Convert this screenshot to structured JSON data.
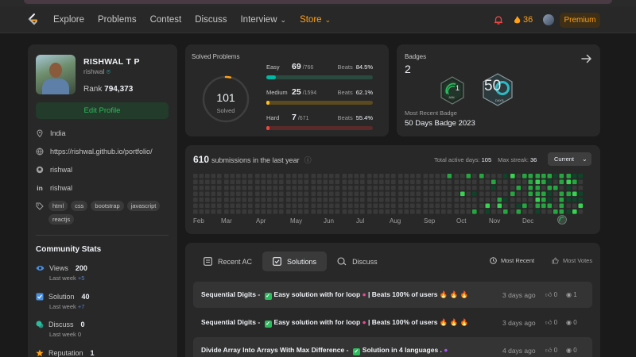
{
  "nav": {
    "links": [
      "Explore",
      "Problems",
      "Contest",
      "Discuss",
      "Interview",
      "Store"
    ],
    "streak": "36",
    "premium_label": "Premium"
  },
  "profile": {
    "name": "RISHWAL T P",
    "handle": "rishwal",
    "rank_label": "Rank",
    "rank": "794,373",
    "edit_label": "Edit Profile",
    "location": "India",
    "website": "https://rishwal.github.io/portfolio/",
    "github": "rishwal",
    "linkedin": "rishwal",
    "skills": [
      "html",
      "css",
      "bootstrap",
      "javascript",
      "reactjs"
    ]
  },
  "community": {
    "title": "Community Stats",
    "stats": [
      {
        "label": "Views",
        "value": "200",
        "sub_label": "Last week",
        "sub_value": "+5",
        "color": "#4a90e2"
      },
      {
        "label": "Solution",
        "value": "40",
        "sub_label": "Last week",
        "sub_value": "+7",
        "color": "#4a90e2"
      },
      {
        "label": "Discuss",
        "value": "0",
        "sub_label": "Last week",
        "sub_value": "0",
        "color": "#2cbb9d"
      },
      {
        "label": "Reputation",
        "value": "1",
        "sub_label": "",
        "sub_value": "",
        "color": "#ffa116"
      }
    ]
  },
  "solved": {
    "title": "Solved Problems",
    "total": "101",
    "total_label": "Solved",
    "difficulties": [
      {
        "label": "Easy",
        "solved": "69",
        "total": "/766",
        "beats_label": "Beats",
        "beats": "84.5%",
        "fraction": 0.09,
        "color": "#00b8a3",
        "track": "#2a4a3f"
      },
      {
        "label": "Medium",
        "solved": "25",
        "total": "/1594",
        "beats_label": "Beats",
        "beats": "62.1%",
        "fraction": 0.016,
        "color": "#ffc01e",
        "track": "#5a4a1f"
      },
      {
        "label": "Hard",
        "solved": "7",
        "total": "/671",
        "beats_label": "Beats",
        "beats": "55.4%",
        "fraction": 0.01,
        "color": "#ef4743",
        "track": "#5a2a2a"
      }
    ]
  },
  "badges": {
    "title": "Badges",
    "count": "2",
    "recent_label": "Most Recent Badge",
    "recent_name": "50 Days Badge 2023",
    "badge1_day": "1",
    "badge1_month": "JAN",
    "badge2_text": "50",
    "badge2_sub": "DAYS"
  },
  "heatmap": {
    "count": "610",
    "title_suffix": "submissions in the last year",
    "active_label": "Total active days:",
    "active_days": "105",
    "streak_label": "Max streak:",
    "max_streak": "36",
    "select_value": "Current",
    "months": [
      "Feb",
      "Mar",
      "Apr",
      "May",
      "Jun",
      "Jul",
      "Aug",
      "Sep",
      "Oct",
      "Nov",
      "Dec"
    ]
  },
  "solutions": {
    "tabs": [
      "Recent AC",
      "Solutions",
      "Discuss"
    ],
    "sort_options": [
      "Most Recent",
      "Most Votes"
    ],
    "rows": [
      {
        "title_a": "Sequential Digits -",
        "title_b": "Easy solution with for loop",
        "title_c": "| Beats 100% of users",
        "when": "3 days ago",
        "likes": "0",
        "views": "1"
      },
      {
        "title_a": "Sequential Digits -",
        "title_b": "Easy solution with for loop",
        "title_c": "| Beats 100% of users",
        "when": "3 days ago",
        "likes": "0",
        "views": "0"
      },
      {
        "title_a": "Divide Array Into Arrays With Max Difference -",
        "title_b": "Solution in 4 languages .",
        "title_c": "",
        "when": "4 days ago",
        "likes": "0",
        "views": "0"
      }
    ]
  }
}
